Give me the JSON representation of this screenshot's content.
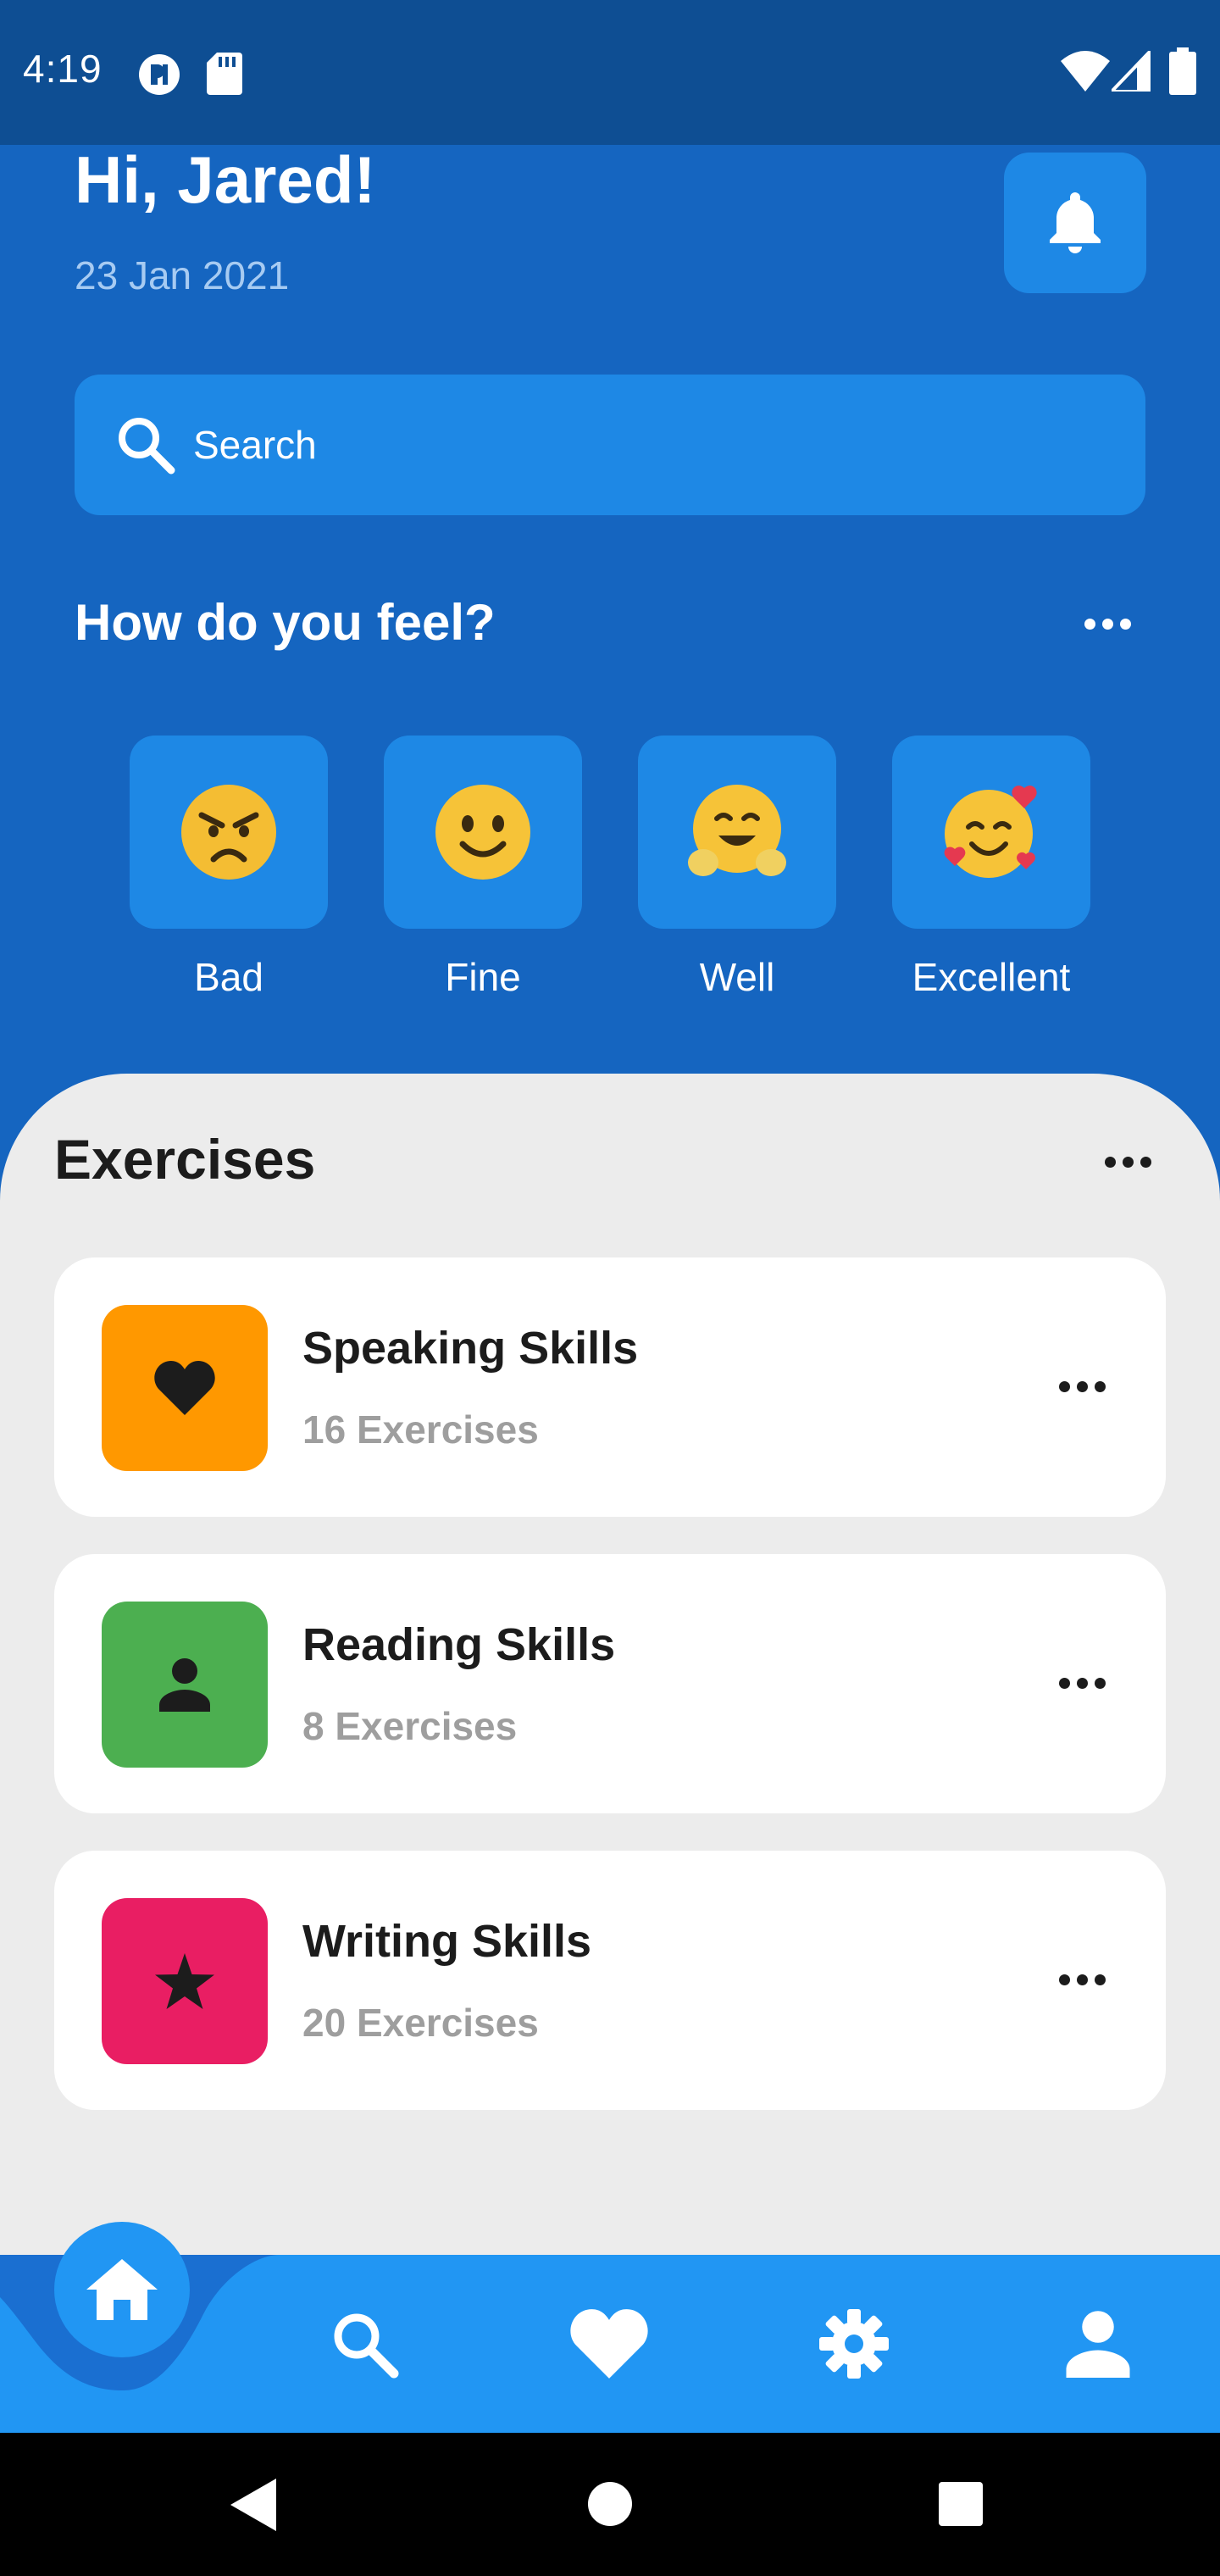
{
  "status_bar": {
    "time": "4:19",
    "icons": [
      "app-notification-icon",
      "sd-card-icon",
      "wifi-icon",
      "signal-icon",
      "battery-icon"
    ]
  },
  "header": {
    "greeting": "Hi, Jared!",
    "date": "23 Jan 2021",
    "notification_icon": "bell-icon"
  },
  "search": {
    "placeholder": "Search",
    "icon": "search-icon"
  },
  "feel": {
    "title": "How do you feel?",
    "moods": [
      {
        "label": "Bad",
        "emoji": "😠"
      },
      {
        "label": "Fine",
        "emoji": "🙂"
      },
      {
        "label": "Well",
        "emoji": "🤗"
      },
      {
        "label": "Excellent",
        "emoji": "🥰"
      }
    ]
  },
  "exercises": {
    "title": "Exercises",
    "items": [
      {
        "title": "Speaking Skills",
        "count": "16 Exercises",
        "icon": "heart-icon",
        "color": "#ff9800"
      },
      {
        "title": "Reading Skills",
        "count": "8 Exercises",
        "icon": "person-icon",
        "color": "#4caf50"
      },
      {
        "title": "Writing Skills",
        "count": "20 Exercises",
        "icon": "star-icon",
        "color": "#e91e63"
      }
    ]
  },
  "bottom_nav": {
    "items": [
      "home-icon",
      "search-icon",
      "heart-icon",
      "settings-icon",
      "person-icon"
    ],
    "active": "home-icon",
    "color": "#2196f3"
  },
  "colors": {
    "header_bg": "#1565c0",
    "tile_bg": "#1e88e5",
    "sheet_bg": "#ececec"
  }
}
